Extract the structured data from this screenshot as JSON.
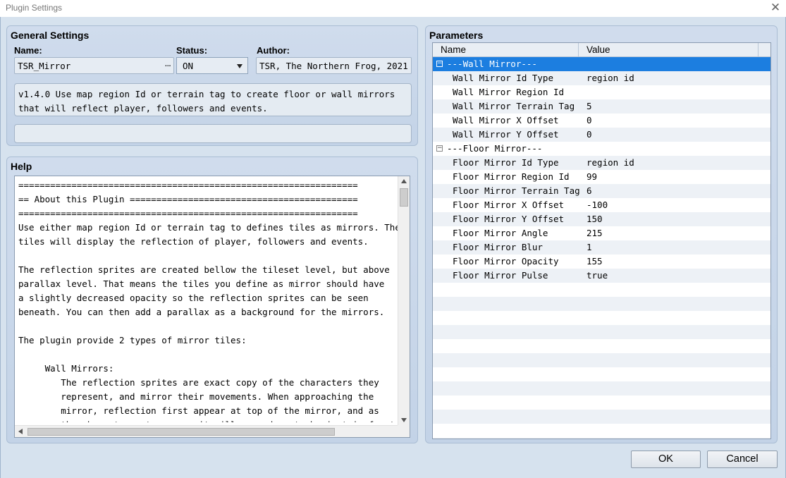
{
  "window": {
    "title": "Plugin Settings",
    "close_glyph": "✕"
  },
  "general": {
    "heading": "General Settings",
    "name_label": "Name:",
    "name_value": "TSR_Mirror",
    "name_button": "...",
    "status_label": "Status:",
    "status_value": "ON",
    "author_label": "Author:",
    "author_value": "TSR, The Northern Frog, 2021",
    "description": "v1.4.0 Use map region Id or terrain tag to create floor or wall mirrors\nthat will reflect player, followers and events.",
    "note": ""
  },
  "help": {
    "heading": "Help",
    "text": "================================================================\n== About this Plugin ===========================================\n================================================================\nUse either map region Id or terrain tag to defines tiles as mirrors. These\ntiles will display the reflection of player, followers and events.\n\nThe reflection sprites are created bellow the tileset level, but above\nparallax level. That means the tiles you define as mirror should have\na slightly decreased opacity so the reflection sprites can be seen\nbeneath. You can then add a parallax as a background for the mirrors.\n\nThe plugin provide 2 types of mirror tiles:\n\n     Wall Mirrors:\n        The reflection sprites are exact copy of the characters they\n        represent, and mirror their movements. When approaching the\n        mirror, reflection first appear at top of the mirror, and as\n        the character get nearer, it will move down to be just in front"
  },
  "parameters": {
    "heading": "Parameters",
    "col_name": "Name",
    "col_value": "Value",
    "groups": [
      {
        "toggle": "−",
        "label": "---Wall Mirror---",
        "selected": true,
        "rows": [
          {
            "name": "Wall Mirror Id Type",
            "value": "region id"
          },
          {
            "name": "Wall Mirror Region Id",
            "value": ""
          },
          {
            "name": "Wall Mirror Terrain Tag",
            "value": "5"
          },
          {
            "name": "Wall Mirror X Offset",
            "value": "0"
          },
          {
            "name": "Wall Mirror Y Offset",
            "value": "0"
          }
        ]
      },
      {
        "toggle": "−",
        "label": "---Floor Mirror---",
        "selected": false,
        "rows": [
          {
            "name": "Floor Mirror Id Type",
            "value": "region id"
          },
          {
            "name": "Floor Mirror Region Id",
            "value": "99"
          },
          {
            "name": "Floor Mirror Terrain Tag",
            "value": "6"
          },
          {
            "name": "Floor Mirror X Offset",
            "value": "-100"
          },
          {
            "name": "Floor Mirror Y Offset",
            "value": "150"
          },
          {
            "name": "Floor Mirror Angle",
            "value": "215"
          },
          {
            "name": "Floor Mirror Blur",
            "value": "1"
          },
          {
            "name": "Floor Mirror Opacity",
            "value": "155"
          },
          {
            "name": "Floor Mirror Pulse",
            "value": "true"
          }
        ]
      }
    ]
  },
  "buttons": {
    "ok": "OK",
    "cancel": "Cancel"
  },
  "colors": {
    "selection": "#1c7ee0",
    "panel_bg": "#c8d7ea"
  }
}
